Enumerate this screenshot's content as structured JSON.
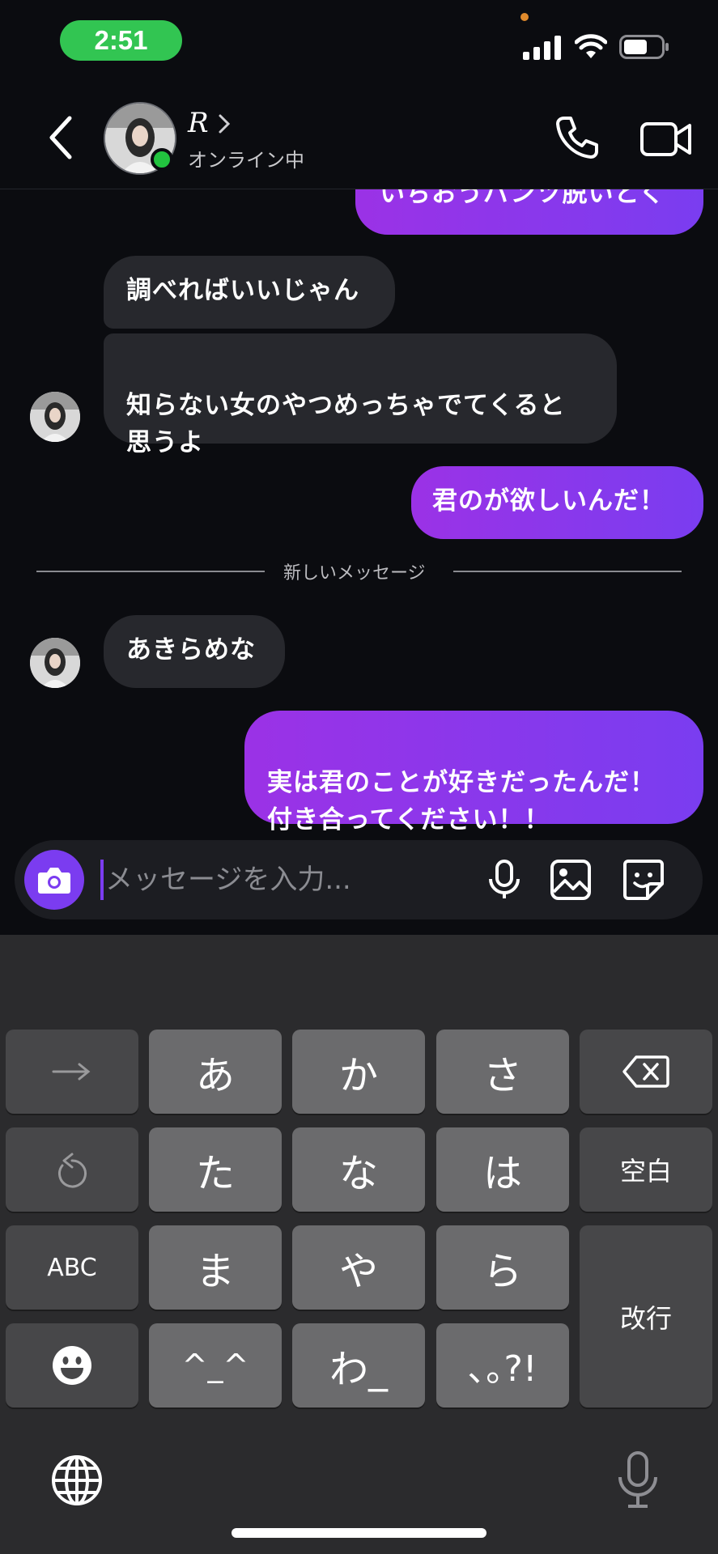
{
  "status_bar": {
    "time": "2:51"
  },
  "header": {
    "contact_name": "R",
    "contact_status": "オンライン中"
  },
  "messages": [
    {
      "side": "outgoing",
      "text": "いちおうパンツ脱いとく"
    },
    {
      "side": "incoming",
      "text": "調べればいいじゃん"
    },
    {
      "side": "incoming",
      "text": "知らない女のやつめっちゃでてくると\n思うよ"
    },
    {
      "side": "outgoing",
      "text": "君のが欲しいんだ！"
    },
    {
      "side": "incoming",
      "text": "あきらめな"
    },
    {
      "side": "outgoing",
      "text": "実は君のことが好きだったんだ！\n付き合ってください！！"
    }
  ],
  "divider_label": "新しいメッセージ",
  "input": {
    "placeholder": "メッセージを入力..."
  },
  "keyboard": {
    "row1": [
      "あ",
      "か",
      "さ"
    ],
    "row2": [
      "た",
      "な",
      "は"
    ],
    "row3": [
      "ま",
      "や",
      "ら"
    ],
    "row4": [
      "^_^",
      "わ_",
      "､｡?!"
    ],
    "space": "空白",
    "abc": "ABC",
    "return": "改行"
  },
  "colors": {
    "accent": "#7b3cf0",
    "online": "#22c33f",
    "time_pill": "#32c552"
  }
}
